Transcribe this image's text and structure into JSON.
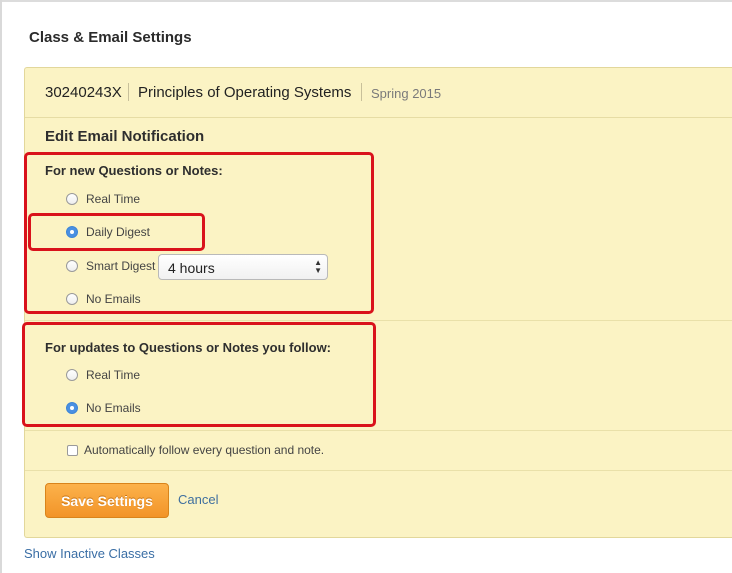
{
  "page_title": "Class & Email Settings",
  "class_info": {
    "code": "30240243X",
    "name": "Principles of Operating Systems",
    "term": "Spring 2015"
  },
  "email_notification": {
    "heading": "Edit Email Notification",
    "new_posts": {
      "title": "For new Questions or Notes:",
      "options": [
        "Real Time",
        "Daily Digest",
        "Smart Digest",
        "No Emails"
      ],
      "selected": "Daily Digest",
      "smart_digest_interval": "4 hours"
    },
    "followed_updates": {
      "title": "For updates to Questions or Notes you follow:",
      "options": [
        "Real Time",
        "No Emails"
      ],
      "selected": "No Emails"
    },
    "auto_follow_label": "Automatically follow every question and note.",
    "auto_follow_checked": false
  },
  "actions": {
    "save_label": "Save Settings",
    "cancel_label": "Cancel"
  },
  "footer_link": "Show Inactive Classes",
  "colors": {
    "panel_background": "#fbf3c4",
    "save_button": "#f29428",
    "link": "#3a6ea5",
    "radio_selected": "#4a90e2",
    "highlight_annotation": "#d9121b"
  }
}
